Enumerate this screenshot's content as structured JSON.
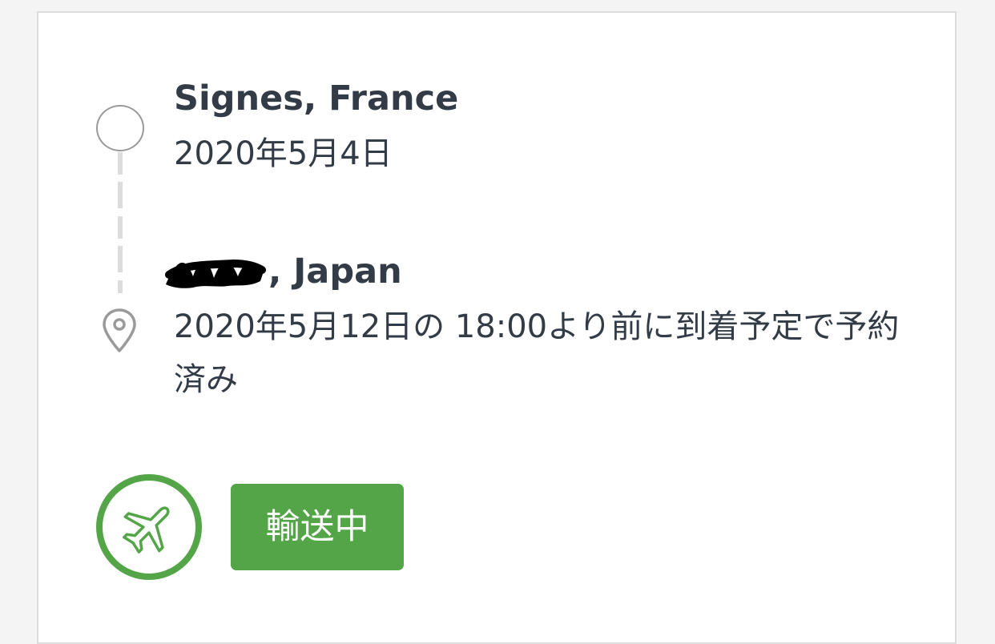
{
  "shipment": {
    "origin": {
      "place": "Signes, France",
      "date": "2020年5月4日"
    },
    "destination": {
      "place_suffix": ", Japan",
      "estimate": "2020年5月12日の 18:00より前に到着予定で予約済み"
    },
    "status": {
      "icon": "airplane-icon",
      "label": "輸送中"
    }
  },
  "colors": {
    "status_green": "#53a548",
    "text_dark": "#333c46",
    "marker_gray": "#9a9a9a",
    "line_gray": "#dcdcdc"
  }
}
